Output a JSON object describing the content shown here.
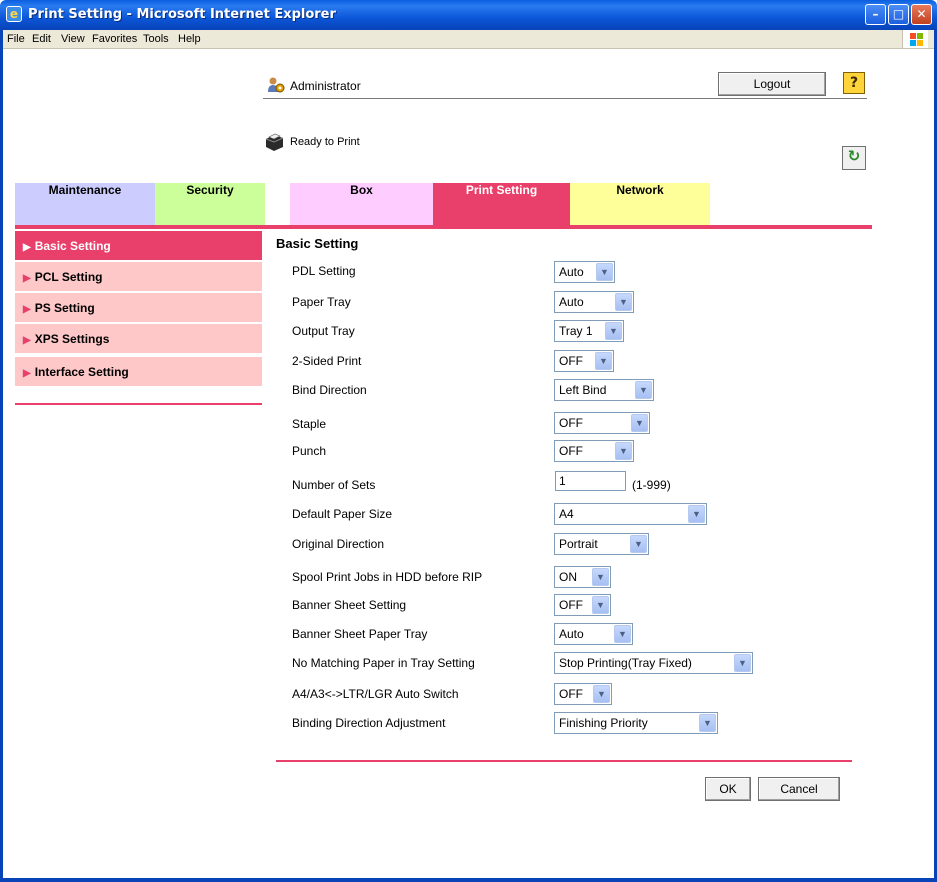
{
  "window": {
    "title": "Print Setting - Microsoft Internet Explorer",
    "min": "–",
    "max": "□",
    "close": "✕"
  },
  "menu": [
    "File",
    "Edit",
    "View",
    "Favorites",
    "Tools",
    "Help"
  ],
  "header": {
    "user": "Administrator",
    "logout": "Logout",
    "help": "?",
    "status": "Ready to Print",
    "refresh": "↻"
  },
  "tabs": [
    {
      "label": "Maintenance",
      "color": "#ccccff"
    },
    {
      "label": "Security",
      "color": "#ccff99"
    },
    {
      "label": "Box",
      "color": "#ffccff"
    },
    {
      "label": "Print Setting",
      "color": "#e8406a"
    },
    {
      "label": "Network",
      "color": "#ffff99"
    }
  ],
  "sidebar": [
    {
      "label": "Basic Setting",
      "active": true
    },
    {
      "label": "PCL Setting",
      "active": false
    },
    {
      "label": "PS Setting",
      "active": false
    },
    {
      "label": "XPS Settings",
      "active": false
    },
    {
      "label": "Interface Setting",
      "active": false
    }
  ],
  "main": {
    "title": "Basic Setting",
    "rows": [
      {
        "label": "PDL Setting",
        "value": "Auto"
      },
      {
        "label": "Paper Tray",
        "value": "Auto"
      },
      {
        "label": "Output Tray",
        "value": "Tray 1"
      },
      {
        "label": "2-Sided Print",
        "value": "OFF"
      },
      {
        "label": "Bind Direction",
        "value": "Left Bind"
      },
      {
        "label": "Staple",
        "value": "OFF"
      },
      {
        "label": "Punch",
        "value": "OFF"
      },
      {
        "label": "Number of Sets",
        "value": "1",
        "note": "(1-999)"
      },
      {
        "label": "Default Paper Size",
        "value": "A4"
      },
      {
        "label": "Original Direction",
        "value": "Portrait"
      },
      {
        "label": "Spool Print Jobs in HDD before RIP",
        "value": "ON"
      },
      {
        "label": "Banner Sheet Setting",
        "value": "OFF"
      },
      {
        "label": "Banner Sheet Paper Tray",
        "value": "Auto"
      },
      {
        "label": "No Matching Paper in Tray Setting",
        "value": "Stop Printing(Tray Fixed)"
      },
      {
        "label": "A4/A3<->LTR/LGR Auto Switch",
        "value": "OFF"
      },
      {
        "label": "Binding Direction Adjustment",
        "value": "Finishing Priority"
      }
    ],
    "ok": "OK",
    "cancel": "Cancel"
  },
  "icons": {
    "dropdown": "▼",
    "arrow": "▶"
  }
}
